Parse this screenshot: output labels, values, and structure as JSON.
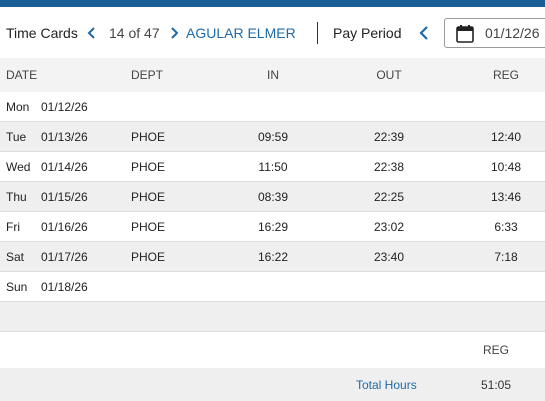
{
  "header": {
    "title": "Time Cards",
    "counter": "14 of 47",
    "employee": "AGULAR ELMER",
    "pay_period_label": "Pay Period",
    "date_value": "01/12/26",
    "accent_color": "#1b5e96",
    "link_color": "#1e6aa8",
    "icons": [
      "chevron-left-icon",
      "chevron-right-icon",
      "calendar-icon"
    ]
  },
  "columns": {
    "date": "DATE",
    "dept": "DEPT",
    "in": "IN",
    "out": "OUT",
    "reg": "REG"
  },
  "rows": [
    {
      "day": "Mon",
      "date": "01/12/26",
      "dept": "",
      "in": "",
      "out": "",
      "reg": ""
    },
    {
      "day": "Tue",
      "date": "01/13/26",
      "dept": "PHOE",
      "in": "09:59",
      "out": "22:39",
      "reg": "12:40"
    },
    {
      "day": "Wed",
      "date": "01/14/26",
      "dept": "PHOE",
      "in": "11:50",
      "out": "22:38",
      "reg": "10:48"
    },
    {
      "day": "Thu",
      "date": "01/15/26",
      "dept": "PHOE",
      "in": "08:39",
      "out": "22:25",
      "reg": "13:46"
    },
    {
      "day": "Fri",
      "date": "01/16/26",
      "dept": "PHOE",
      "in": "16:29",
      "out": "23:02",
      "reg": "6:33"
    },
    {
      "day": "Sat",
      "date": "01/17/26",
      "dept": "PHOE",
      "in": "16:22",
      "out": "23:40",
      "reg": "7:18"
    },
    {
      "day": "Sun",
      "date": "01/18/26",
      "dept": "",
      "in": "",
      "out": "",
      "reg": ""
    }
  ],
  "summary": {
    "reg_header": "REG",
    "total_label": "Total Hours",
    "total_value": "51:05"
  }
}
